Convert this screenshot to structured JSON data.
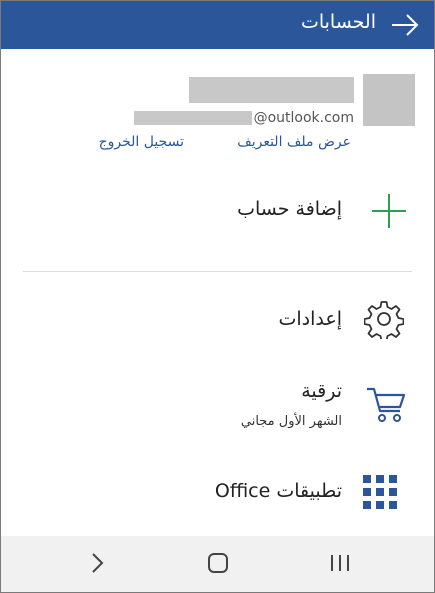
{
  "header": {
    "title": "الحسابات",
    "back_icon": "arrow-right-icon",
    "color": "#2b579a"
  },
  "account": {
    "email_domain": "@outlook.com",
    "view_profile": "عرض ملف التعريف",
    "sign_out": "تسجيل الخروج"
  },
  "menu": {
    "add_account": {
      "label": "إضافة حساب",
      "icon": "plus-icon",
      "icon_color": "#2e9e4f"
    },
    "settings": {
      "label": "إعدادات",
      "icon": "gear-icon"
    },
    "upgrade": {
      "label": "ترقية",
      "sublabel": "الشهر الأول مجاني",
      "icon": "cart-icon",
      "icon_color": "#2b579a"
    },
    "office_apps": {
      "label": "تطبيقات Office",
      "icon": "app-grid-icon",
      "icon_color": "#2b579a"
    }
  },
  "navbar": {
    "back": "chevron-icon",
    "home": "home-icon",
    "recents": "recents-icon"
  }
}
